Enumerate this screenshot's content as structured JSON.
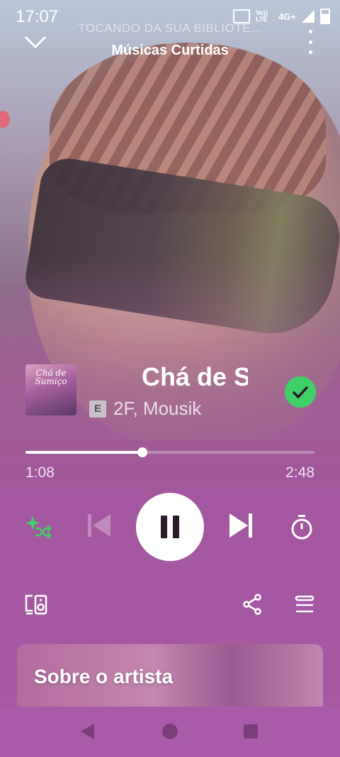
{
  "status_bar": {
    "time": "17:07",
    "volte_label": "Vo)) LTE",
    "network": "4G+"
  },
  "header": {
    "context": "TOCANDO DA SUA BIBLIOTE...",
    "playlist": "Músicas Curtidas"
  },
  "track": {
    "cover_text": "Chá de Sumiço",
    "title": "Chá de Su",
    "explicit_badge": "E",
    "artists": "2F, Mousik",
    "liked": true
  },
  "playback": {
    "elapsed": "1:08",
    "duration": "2:48",
    "progress_fraction": 0.405,
    "is_playing": true
  },
  "about_card": {
    "label": "Sobre o artista"
  },
  "colors": {
    "accent_green": "#3fd167",
    "background_purple": "#a85aa4"
  },
  "icons": {
    "collapse": "chevron-down-icon",
    "more": "more-vertical-icon",
    "smart_shuffle": "smart-shuffle-icon",
    "previous": "skip-previous-icon",
    "pause": "pause-icon",
    "next": "skip-next-icon",
    "sleep_timer": "timer-icon",
    "devices": "connect-device-icon",
    "share": "share-icon",
    "queue": "queue-icon"
  }
}
